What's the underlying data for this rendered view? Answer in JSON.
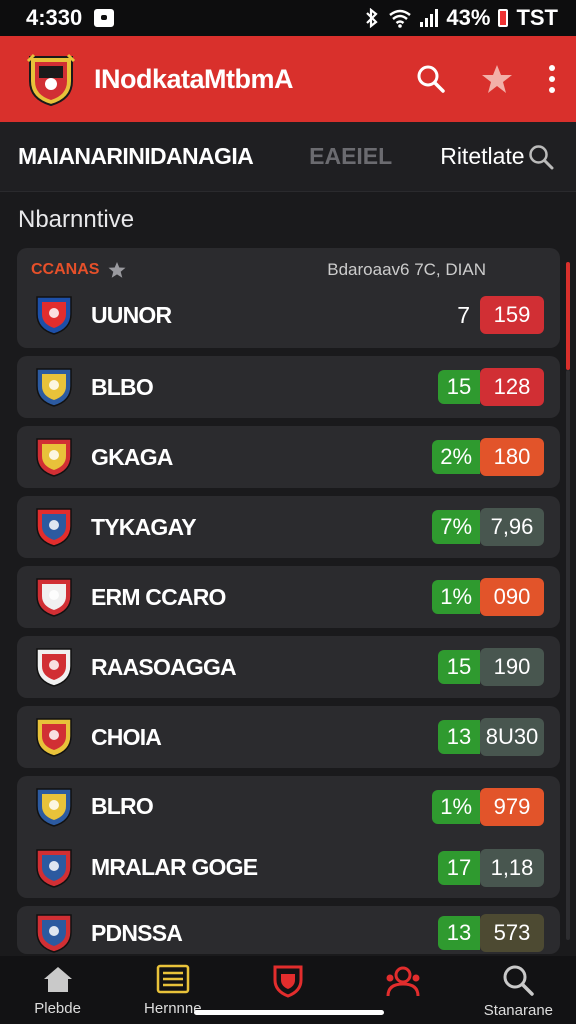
{
  "status_bar": {
    "time": "4:330",
    "battery": "43%",
    "network": "TST"
  },
  "app_bar": {
    "title": "INodkataMtbmA"
  },
  "tabs": {
    "main": "MAIANARINIDANAGIA",
    "middle": "EAEIEL",
    "right": "Ritetlate"
  },
  "section_label": "Nbarnntive",
  "list_header": {
    "tag": "CCANAS",
    "info": "Bdaroaav6 7C, DIAN"
  },
  "teams": [
    {
      "name": "UUNOR",
      "left": "7",
      "value": "159",
      "value_color": "#d12f34",
      "crest_colors": [
        "#1d4fa8",
        "#e22d2d"
      ]
    },
    {
      "name": "BLBO",
      "left": "15",
      "value": "128",
      "value_color": "#d12f34",
      "crest_colors": [
        "#2c5aa0",
        "#e8c23a"
      ]
    },
    {
      "name": "GKAGA",
      "left": "2%",
      "value": "180",
      "value_color": "#e2542a",
      "crest_colors": [
        "#d12f34",
        "#e8c23a"
      ]
    },
    {
      "name": "TYKAGAY",
      "left": "7%",
      "value": "7,96",
      "value_color": "#48564f",
      "crest_colors": [
        "#e22d2d",
        "#2c5aa0"
      ]
    },
    {
      "name": "ERM CCARO",
      "left": "1%",
      "value": "090",
      "value_color": "#e2542a",
      "crest_colors": [
        "#d12f34",
        "#f0f0f0"
      ]
    },
    {
      "name": "RAASOAGGA",
      "left": "15",
      "value": "190",
      "value_color": "#48564f",
      "crest_colors": [
        "#f0f0f0",
        "#d12f34"
      ]
    },
    {
      "name": "CHOIA",
      "left": "13",
      "value": "8U30",
      "value_color": "#48564f",
      "crest_colors": [
        "#e8c23a",
        "#d12f34"
      ]
    },
    {
      "name": "BLRO",
      "left": "1%",
      "value": "979",
      "value_color": "#e2542a",
      "crest_colors": [
        "#2c5aa0",
        "#e8c23a"
      ]
    },
    {
      "name": "MRALAR GOGE",
      "left": "17",
      "value": "1,18",
      "value_color": "#48564f",
      "crest_colors": [
        "#d12f34",
        "#2c5aa0"
      ]
    },
    {
      "name": "PDNSSA",
      "left": "13",
      "value": "573",
      "value_color": "#4d4a32",
      "crest_colors": [
        "#d12f34",
        "#2c5aa0"
      ]
    }
  ],
  "bottom_nav": [
    {
      "label": "Plebde",
      "icon": "home-icon"
    },
    {
      "label": "Hernnne",
      "icon": "list-icon"
    },
    {
      "label": "",
      "icon": "shield-icon"
    },
    {
      "label": "",
      "icon": "people-icon"
    },
    {
      "label": "Stanarane",
      "icon": "search-icon"
    }
  ],
  "colors": {
    "accent": "#d9302c",
    "background": "#1a1a1c",
    "card": "#2b2b2e",
    "green": "#2f9a2f"
  }
}
